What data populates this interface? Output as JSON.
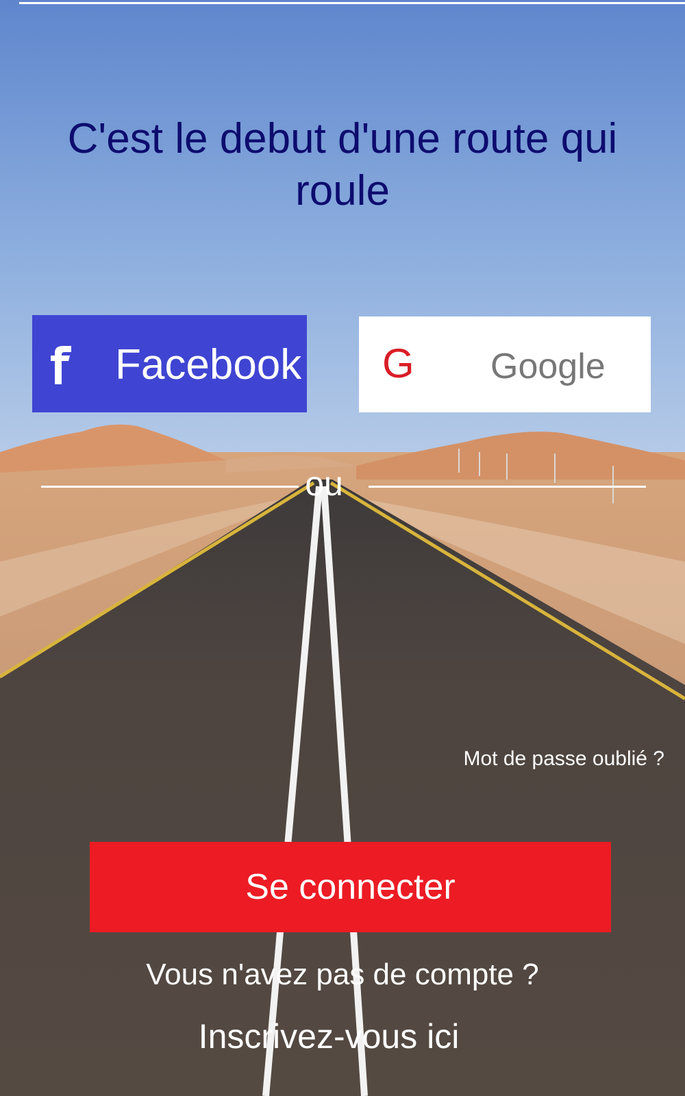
{
  "headline": "C'est le debut d'une route qui roule",
  "social": {
    "facebook": {
      "label": "Facebook",
      "icon": "facebook-f-icon",
      "color": "#3f45d2"
    },
    "google": {
      "label": "Google",
      "icon": "google-g-icon",
      "icon_glyph": "G",
      "icon_color": "#d91e26",
      "label_color": "#777777"
    }
  },
  "separator": {
    "label": "ou"
  },
  "forgot_password": "Mot de passe oublié ?",
  "login_button": {
    "label": "Se connecter",
    "color": "#ec1b24"
  },
  "no_account": "Vous n'avez pas de compte ?",
  "signup_link": "Inscrivez-vous ici",
  "colors": {
    "headline": "#0d0c6e",
    "sky_top": "#6289cf",
    "sky_bottom": "#a9c1e3",
    "sand": "#d39b6f",
    "asphalt": "#4a423d"
  }
}
